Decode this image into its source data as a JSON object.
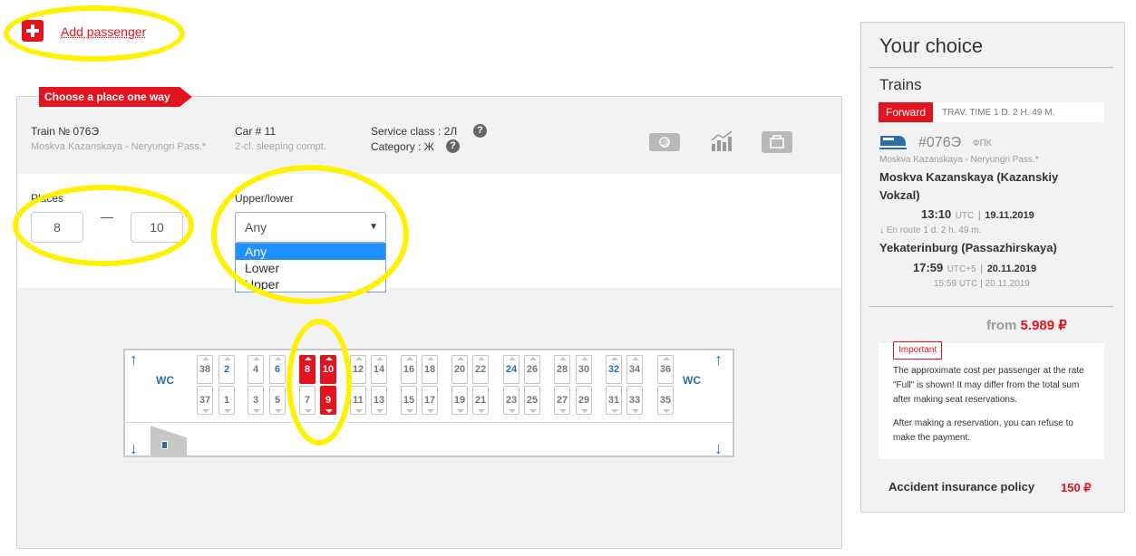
{
  "add_passenger": {
    "label": "Add passenger"
  },
  "tag": {
    "label": "Choose a place one way"
  },
  "train_info": {
    "train_label": "Train №  076Э",
    "route": "Moskva Kazanskaya - Neryungri Pass.*",
    "car_label": "Car # 11",
    "car_type": "2-cl. sleeping compt.",
    "service_class": "Service class : 2Л",
    "category": "Category : Ж",
    "help": "?"
  },
  "filters": {
    "places_label": "Places",
    "places_from": "8",
    "places_to": "10",
    "upper_lower_label": "Upper/lower",
    "selected": "Any",
    "options": [
      "Any",
      "Lower",
      "Upper"
    ]
  },
  "car_map": {
    "wc_label": "WC",
    "seats": [
      {
        "n": "38",
        "pos": "top",
        "state": "taken"
      },
      {
        "n": "37",
        "pos": "bot",
        "state": "taken"
      },
      {
        "n": "2",
        "pos": "top",
        "state": "free"
      },
      {
        "n": "1",
        "pos": "bot",
        "state": "taken"
      },
      {
        "n": "4",
        "pos": "top",
        "state": "taken"
      },
      {
        "n": "3",
        "pos": "bot",
        "state": "taken"
      },
      {
        "n": "6",
        "pos": "top",
        "state": "free"
      },
      {
        "n": "5",
        "pos": "bot",
        "state": "taken"
      },
      {
        "n": "8",
        "pos": "top",
        "state": "selected"
      },
      {
        "n": "7",
        "pos": "bot",
        "state": "taken"
      },
      {
        "n": "10",
        "pos": "top",
        "state": "selected"
      },
      {
        "n": "9",
        "pos": "bot",
        "state": "selected"
      },
      {
        "n": "12",
        "pos": "top",
        "state": "taken"
      },
      {
        "n": "11",
        "pos": "bot",
        "state": "taken"
      },
      {
        "n": "14",
        "pos": "top",
        "state": "taken"
      },
      {
        "n": "13",
        "pos": "bot",
        "state": "taken"
      },
      {
        "n": "16",
        "pos": "top",
        "state": "taken"
      },
      {
        "n": "15",
        "pos": "bot",
        "state": "taken"
      },
      {
        "n": "18",
        "pos": "top",
        "state": "taken"
      },
      {
        "n": "17",
        "pos": "bot",
        "state": "taken"
      },
      {
        "n": "20",
        "pos": "top",
        "state": "taken"
      },
      {
        "n": "19",
        "pos": "bot",
        "state": "taken"
      },
      {
        "n": "22",
        "pos": "top",
        "state": "taken"
      },
      {
        "n": "21",
        "pos": "bot",
        "state": "taken"
      },
      {
        "n": "24",
        "pos": "top",
        "state": "free"
      },
      {
        "n": "23",
        "pos": "bot",
        "state": "taken"
      },
      {
        "n": "26",
        "pos": "top",
        "state": "taken"
      },
      {
        "n": "25",
        "pos": "bot",
        "state": "taken"
      },
      {
        "n": "28",
        "pos": "top",
        "state": "taken"
      },
      {
        "n": "27",
        "pos": "bot",
        "state": "taken"
      },
      {
        "n": "30",
        "pos": "top",
        "state": "taken"
      },
      {
        "n": "29",
        "pos": "bot",
        "state": "taken"
      },
      {
        "n": "32",
        "pos": "top",
        "state": "free"
      },
      {
        "n": "31",
        "pos": "bot",
        "state": "taken"
      },
      {
        "n": "34",
        "pos": "top",
        "state": "taken"
      },
      {
        "n": "33",
        "pos": "bot",
        "state": "taken"
      },
      {
        "n": "36",
        "pos": "top",
        "state": "taken"
      },
      {
        "n": "35",
        "pos": "bot",
        "state": "taken"
      }
    ]
  },
  "sidebar": {
    "title": "Your choice",
    "section": "Trains",
    "direction": "Forward",
    "travel_time": "TRAV. TIME 1 D. 2 H. 49 M.",
    "train_number": "#076Э",
    "carrier": "ФПК",
    "route": "Moskva Kazanskaya - Neryungri Pass.*",
    "departure_station": "Moskva Kazanskaya (Kazanskiy Vokzal)",
    "departure_time": "13:10",
    "departure_tz": "UTC",
    "departure_date": "19.11.2019",
    "en_route": "En route  1 d. 2 h. 49 m.",
    "arrival_station": "Yekaterinburg (Passazhirskaya)",
    "arrival_time": "17:59",
    "arrival_tz": "UTC+5",
    "arrival_date": "20.11.2019",
    "arrival_utc_time": "15:59",
    "arrival_utc_label": "UTC",
    "arrival_utc_date": "20.11.2019",
    "sep": "|",
    "price_prefix": "from",
    "price": "5.989 ₽",
    "important_label": "Important",
    "important_text_1": "The approximate cost per passenger at the rate \"Full\" is shown! It may differ from the total sum after making seat reservations.",
    "important_text_2": "After making a reservation, you can refuse to make the payment.",
    "insurance_label": "Accident insurance policy",
    "insurance_price": "150 ₽"
  },
  "colors": {
    "accent": "#e3141f",
    "free_seat": "#2a6ea8",
    "highlight": "#fff200"
  }
}
